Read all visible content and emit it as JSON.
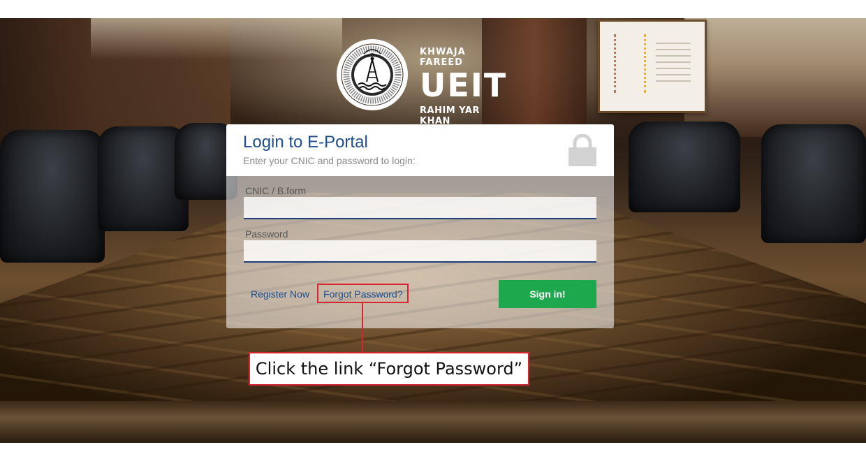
{
  "logo": {
    "top_text": "KHWAJA FAREED",
    "main_text": "UEIT",
    "bottom_text": "RAHIM YAR KHAN",
    "seal_text": "KHWAJA FAREED UNIVERSITY OF ENGINEERING & INFORMATION TECHNOLOGY"
  },
  "login": {
    "title": "Login to E-Portal",
    "subtitle": "Enter your CNIC and password to login:",
    "cnic_label": "CNIC / B.form",
    "cnic_value": "",
    "password_label": "Password",
    "password_value": "",
    "register_link": "Register Now",
    "forgot_link": "Forgot Password?",
    "signin_button": "Sign in!"
  },
  "annotation": {
    "callout_text": "Click the link “Forgot Password”",
    "highlight_color": "#d9252f"
  },
  "colors": {
    "accent_blue": "#1f4e8c",
    "signin_green": "#1ea84d"
  },
  "icons": [
    "lock-icon",
    "antenna-seal-icon"
  ]
}
